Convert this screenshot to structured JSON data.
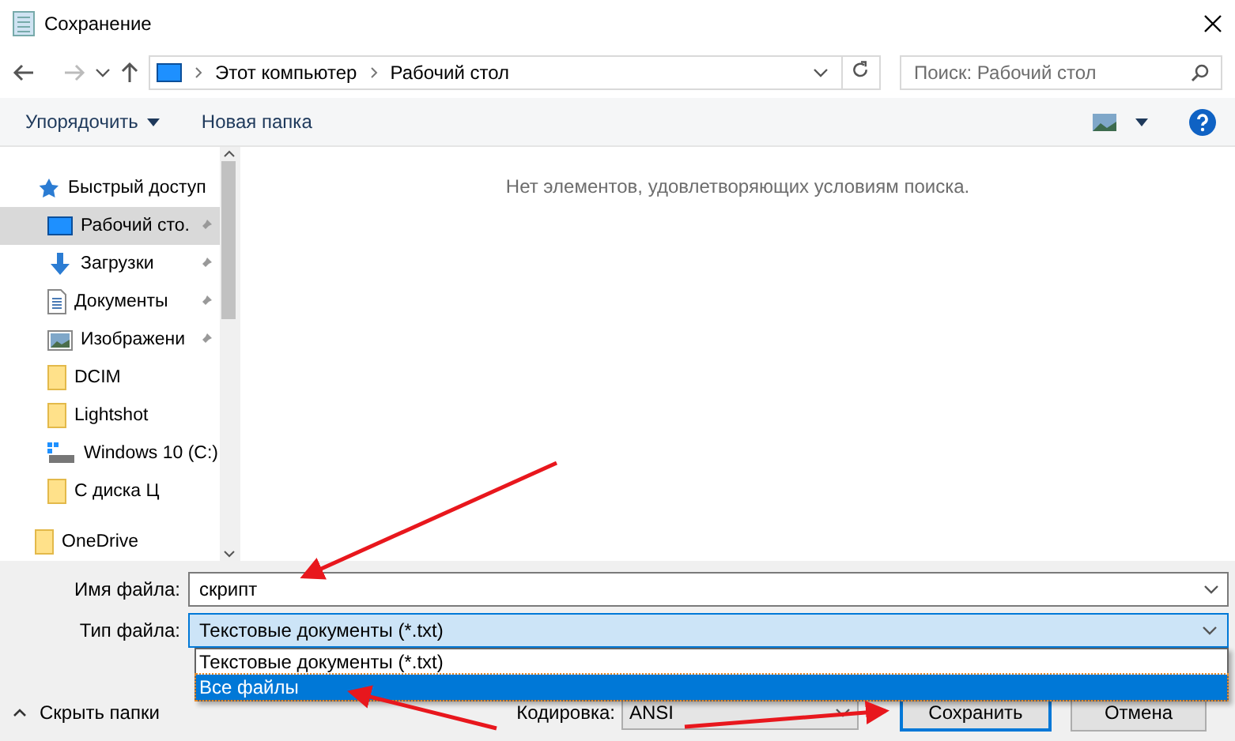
{
  "window": {
    "title": "Сохранение"
  },
  "address": {
    "crumbs": [
      "Этот компьютер",
      "Рабочий стол"
    ]
  },
  "search": {
    "placeholder": "Поиск: Рабочий стол"
  },
  "toolbar": {
    "organize": "Упорядочить",
    "new_folder": "Новая папка"
  },
  "sidebar": {
    "items": [
      {
        "label": "Быстрый доступ",
        "kind": "star",
        "pinned": false,
        "selected": false,
        "top": true
      },
      {
        "label": "Рабочий сто.",
        "kind": "desktop",
        "pinned": true,
        "selected": true,
        "top": false
      },
      {
        "label": "Загрузки",
        "kind": "download",
        "pinned": true,
        "selected": false,
        "top": false
      },
      {
        "label": "Документы",
        "kind": "document",
        "pinned": true,
        "selected": false,
        "top": false
      },
      {
        "label": "Изображени",
        "kind": "image",
        "pinned": true,
        "selected": false,
        "top": false
      },
      {
        "label": "DCIM",
        "kind": "folder",
        "pinned": false,
        "selected": false,
        "top": false
      },
      {
        "label": "Lightshot",
        "kind": "folder",
        "pinned": false,
        "selected": false,
        "top": false
      },
      {
        "label": "Windows 10 (C:)",
        "kind": "drive",
        "pinned": false,
        "selected": false,
        "top": false
      },
      {
        "label": "С диска Ц",
        "kind": "folder",
        "pinned": false,
        "selected": false,
        "top": false
      },
      {
        "label": "OneDrive",
        "kind": "folder",
        "pinned": false,
        "selected": false,
        "top": true
      }
    ]
  },
  "content": {
    "empty_message": "Нет элементов, удовлетворяющих условиям поиска."
  },
  "form": {
    "filename_label": "Имя файла:",
    "filename": "скрипт",
    "type_label": "Тип файла:",
    "type_value": "Текстовые документы (*.txt)",
    "type_options": [
      {
        "label": "Текстовые документы (*.txt)",
        "selected": false
      },
      {
        "label": "Все файлы",
        "selected": true
      }
    ],
    "encoding_label": "Кодировка:",
    "encoding": "ANSI"
  },
  "hide_folders": "Скрыть папки",
  "buttons": [
    {
      "label": "Сохранить",
      "default": true
    },
    {
      "label": "Отмена",
      "default": false
    }
  ]
}
